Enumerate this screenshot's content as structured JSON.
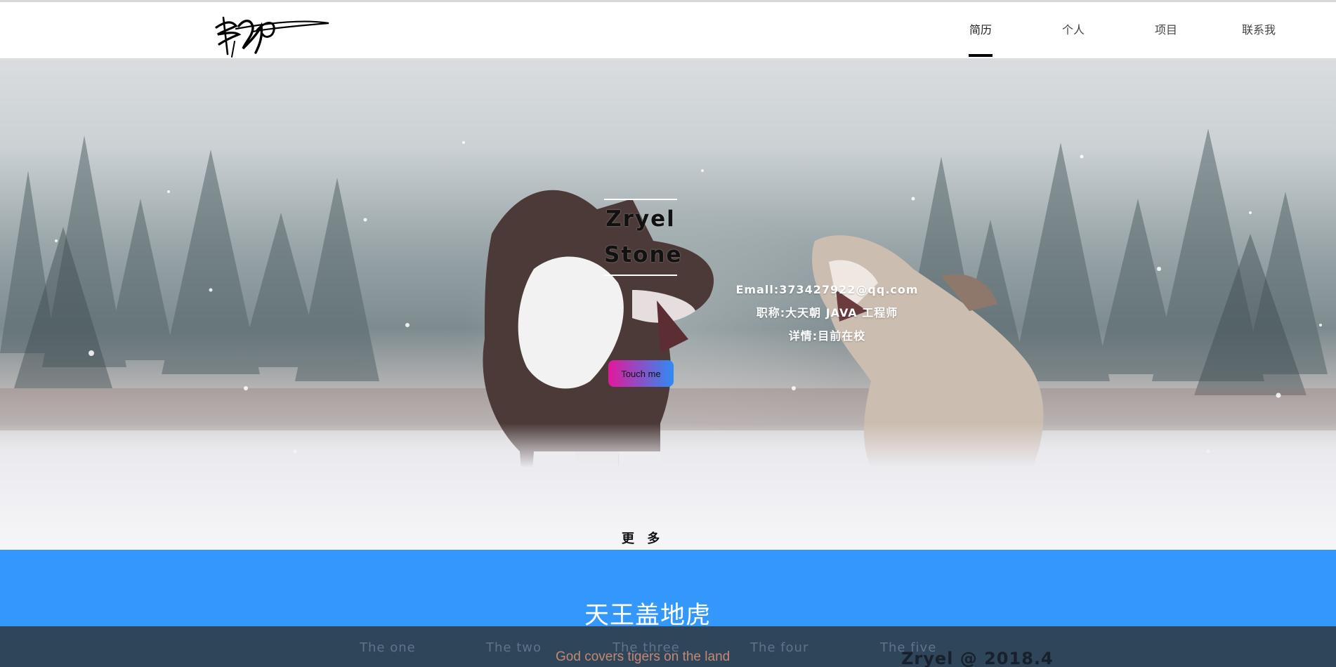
{
  "header": {
    "nav": [
      {
        "label": "简历",
        "active": true
      },
      {
        "label": "个人",
        "active": false
      },
      {
        "label": "项目",
        "active": false
      },
      {
        "label": "联系我",
        "active": false
      }
    ]
  },
  "hero": {
    "name_line1": "Zryel",
    "name_line2": "Stone",
    "email": "Emall:373427922@qq.com",
    "job": "职称:大天朝 JAVA 工程师",
    "detail": "详情:目前在校",
    "button_label": "Touch me",
    "more_label": "更 多",
    "button_gradient": [
      "#e2189b",
      "#2f8bf3"
    ]
  },
  "band": {
    "title": "天王盖地虎",
    "subtitle": "God covers tigers on the land",
    "color": "#3497fb"
  },
  "footer": {
    "tabs": [
      "The one",
      "The two",
      "The three",
      "The four",
      "The five"
    ],
    "copyright": "Zryel @ 2018.4",
    "color": "#2f455a"
  }
}
